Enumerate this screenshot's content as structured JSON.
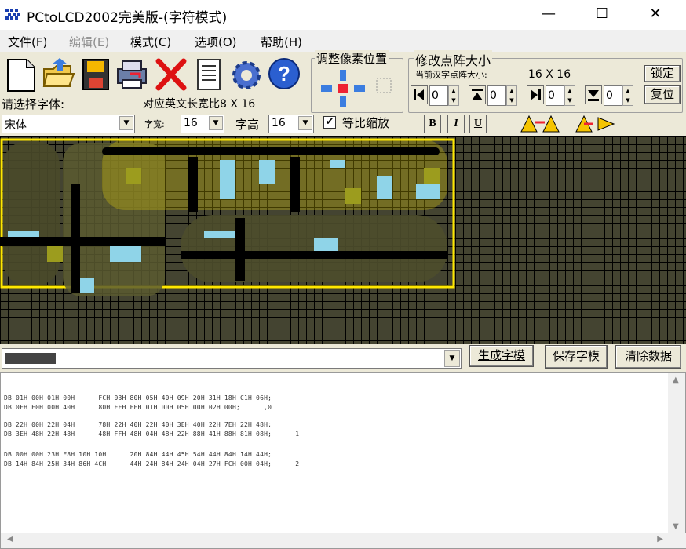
{
  "window": {
    "title": "PCtoLCD2002完美版-(字符模式)",
    "minimize": "—",
    "maximize": "☐",
    "close": "✕"
  },
  "menu": [
    {
      "label": "文件(F)",
      "enabled": true
    },
    {
      "label": "编辑(E)",
      "enabled": false
    },
    {
      "label": "模式(C)",
      "enabled": true
    },
    {
      "label": "选项(O)",
      "enabled": true
    },
    {
      "label": "帮助(H)",
      "enabled": true
    }
  ],
  "toolbar": {
    "icons": [
      "new-file-icon",
      "open-folder-icon",
      "save-disk-icon",
      "printer-icon",
      "delete-x-icon",
      "notepad-icon",
      "settings-gear-icon",
      "help-question-icon"
    ]
  },
  "pixel_adjust": {
    "title": "调整像素位置"
  },
  "matrix_size": {
    "title": "修改点阵大小",
    "current_label": "当前汉字点阵大小:",
    "current_value": "16  X  16",
    "lock_button": "锁定",
    "reset_button": "复位",
    "spin_values": [
      "0",
      "0",
      "0",
      "0"
    ]
  },
  "font": {
    "choose_label": "请选择字体:",
    "ratio_label": "对应英文长宽比8  X  16",
    "font_name": "宋体",
    "width_label": "字宽:",
    "width_value": "16",
    "height_label": "字高",
    "height_value": "16",
    "proportional_label": "等比缩放",
    "proportional_checked": true,
    "bold": "B",
    "italic": "I",
    "underline": "U"
  },
  "actions": {
    "generate_button": "生成字模",
    "save_button": "保存字模",
    "clear_button": "清除数据"
  },
  "output_lines": [
    "DB 01H 00H 01H 00H      FCH 03H 80H 05H 40H 09H 20H 31H 18H C1H 06H;",
    "DB 0FH E0H 00H 40H      80H FFH FEH 01H 00H 05H 00H 02H 00H;      ,0",
    "",
    "DB 22H 00H 22H 04H      78H 22H 40H 22H 40H 3EH 40H 22H 7EH 22H 48H;",
    "DB 3EH 48H 22H 48H      48H FFH 48H 04H 48H 22H 88H 41H 88H 81H 08H;      1",
    "",
    "DB 00H 00H 23H F8H 10H 10H      20H 84H 44H 45H 54H 44H 84H 14H 44H;",
    "DB 14H 84H 25H 34H 86H 4CH      44H 24H 84H 24H 04H 27H FCH 00H 04H;      2"
  ]
}
